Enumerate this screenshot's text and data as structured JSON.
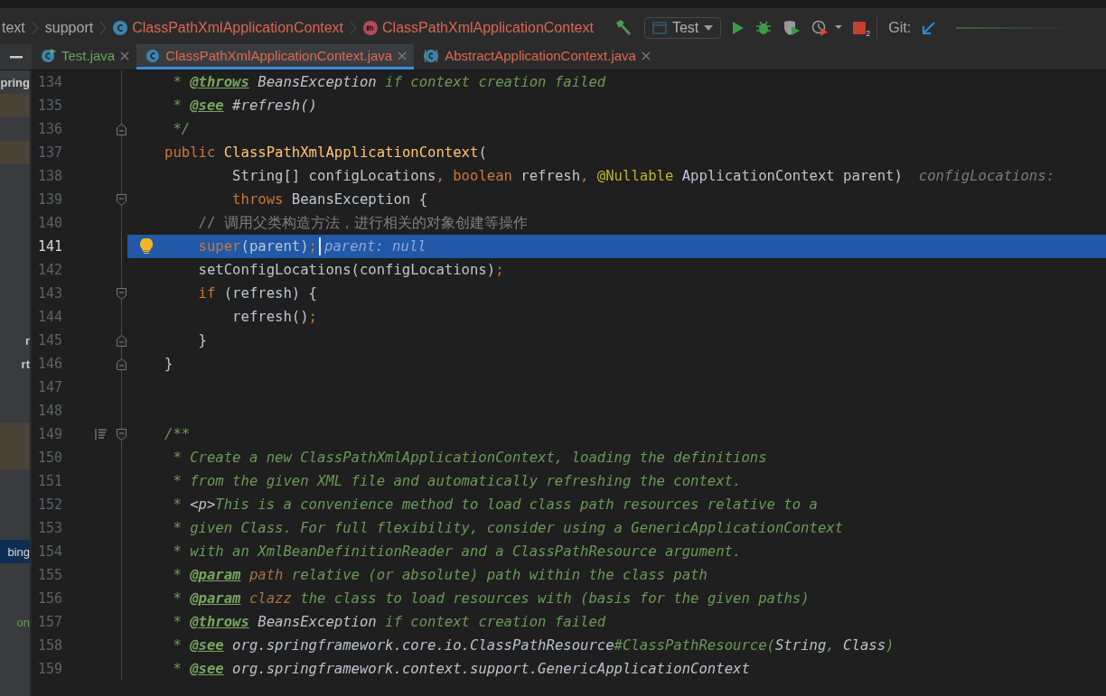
{
  "breadcrumbs": [
    {
      "text": "text",
      "kind": "plain"
    },
    {
      "text": "support",
      "kind": "plain"
    },
    {
      "text": "ClassPathXmlApplicationContext",
      "kind": "class"
    },
    {
      "text": "ClassPathXmlApplicationContext",
      "kind": "method"
    }
  ],
  "toolbar": {
    "run_config": "Test",
    "stop_count": "2",
    "git_label": "Git:"
  },
  "tabs": [
    {
      "label": "Test.java",
      "selected": false,
      "kind": "test-class",
      "color": "#62a85a"
    },
    {
      "label": "ClassPathXmlApplicationContext.java",
      "selected": true,
      "kind": "class",
      "color": "#e0694e"
    },
    {
      "label": "AbstractApplicationContext.java",
      "selected": false,
      "kind": "abstract-class",
      "color": "#e0694e"
    }
  ],
  "sidebar": {
    "items": [
      {
        "kind": "text",
        "text": "pring",
        "selected": false
      },
      {
        "kind": "highlight"
      },
      {
        "kind": "gap"
      },
      {
        "kind": "highlight"
      },
      {
        "kind": "gap"
      },
      {
        "kind": "gap"
      },
      {
        "kind": "gap"
      },
      {
        "kind": "gap"
      },
      {
        "kind": "gap"
      },
      {
        "kind": "gap"
      },
      {
        "kind": "gap"
      },
      {
        "kind": "text",
        "text": "r",
        "selected": false
      },
      {
        "kind": "text",
        "text": "rt",
        "selected": false
      },
      {
        "kind": "gap"
      },
      {
        "kind": "gap"
      },
      {
        "kind": "highlight"
      },
      {
        "kind": "highlight"
      },
      {
        "kind": "gap"
      },
      {
        "kind": "gap"
      },
      {
        "kind": "gap"
      },
      {
        "kind": "text",
        "text": "bing",
        "selected": true
      },
      {
        "kind": "gap"
      },
      {
        "kind": "gap"
      },
      {
        "kind": "modified",
        "text": "on",
        "selected": false
      }
    ]
  },
  "editor": {
    "lines": [
      {
        "number": "134",
        "current": false,
        "tokens": [
          {
            "text": " * ",
            "kind": "comment"
          },
          {
            "text": "@throws",
            "kind": "doc-tag"
          },
          {
            "text": " BeansException",
            "kind": "doc-ref"
          },
          {
            "text": " if context creation failed",
            "kind": "comment"
          }
        ]
      },
      {
        "number": "135",
        "current": false,
        "tokens": [
          {
            "text": " * ",
            "kind": "comment"
          },
          {
            "text": "@see",
            "kind": "doc-tag"
          },
          {
            "text": " #refresh()",
            "kind": "doc-ref"
          }
        ]
      },
      {
        "number": "136",
        "current": false,
        "markers": [
          {
            "kind": "fold-end"
          }
        ],
        "tokens": [
          {
            "text": " */",
            "kind": "comment"
          }
        ]
      },
      {
        "number": "137",
        "current": false,
        "tokens": [
          {
            "text": "public",
            "kind": "keyword"
          },
          {
            "text": " ClassPathXmlApplicationContext",
            "kind": "declaration"
          },
          {
            "text": "(",
            "kind": "plain"
          }
        ]
      },
      {
        "number": "138",
        "current": false,
        "hint": "configLocations:",
        "tokens": [
          {
            "text": "        String[] configLocations",
            "kind": "plain"
          },
          {
            "text": ",",
            "kind": "keyword"
          },
          {
            "text": " boolean",
            "kind": "keyword"
          },
          {
            "text": " refresh",
            "kind": "plain"
          },
          {
            "text": ",",
            "kind": "keyword"
          },
          {
            "text": " @Nullable",
            "kind": "annotation"
          },
          {
            "text": " ApplicationContext parent)",
            "kind": "plain"
          }
        ]
      },
      {
        "number": "139",
        "current": false,
        "markers": [
          {
            "kind": "fold-start"
          }
        ],
        "tokens": [
          {
            "text": "        throws",
            "kind": "keyword"
          },
          {
            "text": " BeansException {",
            "kind": "plain"
          }
        ]
      },
      {
        "number": "140",
        "current": false,
        "tokens": [
          {
            "text": "    // 调用父类构造方法，进行相关的对象创建等操作",
            "kind": "line-comment"
          }
        ]
      },
      {
        "number": "141",
        "current": true,
        "markers": [
          {
            "kind": "bulb"
          }
        ],
        "hint": "parent: null",
        "tokens": [
          {
            "text": "    super",
            "kind": "keyword"
          },
          {
            "text": "(parent)",
            "kind": "plain"
          },
          {
            "text": ";",
            "kind": "keyword"
          }
        ]
      },
      {
        "number": "142",
        "current": false,
        "tokens": [
          {
            "text": "    setConfigLocations(configLocations)",
            "kind": "plain"
          },
          {
            "text": ";",
            "kind": "keyword"
          }
        ]
      },
      {
        "number": "143",
        "current": false,
        "markers": [
          {
            "kind": "fold-start"
          }
        ],
        "tokens": [
          {
            "text": "    if",
            "kind": "keyword"
          },
          {
            "text": " (refresh) {",
            "kind": "plain"
          }
        ]
      },
      {
        "number": "144",
        "current": false,
        "tokens": [
          {
            "text": "        refresh()",
            "kind": "plain"
          },
          {
            "text": ";",
            "kind": "keyword"
          }
        ]
      },
      {
        "number": "145",
        "current": false,
        "markers": [
          {
            "kind": "fold-end"
          }
        ],
        "tokens": [
          {
            "text": "    }",
            "kind": "plain"
          }
        ]
      },
      {
        "number": "146",
        "current": false,
        "markers": [
          {
            "kind": "fold-end"
          }
        ],
        "tokens": [
          {
            "text": "}",
            "kind": "plain"
          }
        ]
      },
      {
        "number": "147",
        "current": false
      },
      {
        "number": "148",
        "current": false
      },
      {
        "number": "149",
        "current": false,
        "markers": [
          {
            "kind": "doc-list"
          },
          {
            "kind": "fold-start"
          }
        ],
        "tokens": [
          {
            "text": "/**",
            "kind": "comment"
          }
        ]
      },
      {
        "number": "150",
        "current": false,
        "tokens": [
          {
            "text": " * Create a new ClassPathXmlApplicationContext, loading the definitions",
            "kind": "comment"
          }
        ]
      },
      {
        "number": "151",
        "current": false,
        "tokens": [
          {
            "text": " * from the given XML file and automatically refreshing the context.",
            "kind": "comment"
          }
        ]
      },
      {
        "number": "152",
        "current": false,
        "tokens": [
          {
            "text": " * ",
            "kind": "comment"
          },
          {
            "text": "<p>",
            "kind": "doc-ref"
          },
          {
            "text": "This is a convenience method to load class path resources relative to a",
            "kind": "comment"
          }
        ]
      },
      {
        "number": "153",
        "current": false,
        "tokens": [
          {
            "text": " * given Class. For full flexibility, consider using a GenericApplicationContext",
            "kind": "comment"
          }
        ]
      },
      {
        "number": "154",
        "current": false,
        "tokens": [
          {
            "text": " * with an XmlBeanDefinitionReader and a ClassPathResource argument.",
            "kind": "comment"
          }
        ]
      },
      {
        "number": "155",
        "current": false,
        "tokens": [
          {
            "text": " * ",
            "kind": "comment"
          },
          {
            "text": "@param",
            "kind": "doc-tag"
          },
          {
            "text": " path",
            "kind": "doc-param"
          },
          {
            "text": " relative (or absolute) path within the class path",
            "kind": "comment"
          }
        ]
      },
      {
        "number": "156",
        "current": false,
        "tokens": [
          {
            "text": " * ",
            "kind": "comment"
          },
          {
            "text": "@param",
            "kind": "doc-tag"
          },
          {
            "text": " clazz",
            "kind": "doc-param"
          },
          {
            "text": " the class to load resources with (basis for the given paths)",
            "kind": "comment"
          }
        ]
      },
      {
        "number": "157",
        "current": false,
        "tokens": [
          {
            "text": " * ",
            "kind": "comment"
          },
          {
            "text": "@throws",
            "kind": "doc-tag"
          },
          {
            "text": " BeansException",
            "kind": "doc-ref"
          },
          {
            "text": " if context creation failed",
            "kind": "comment"
          }
        ]
      },
      {
        "number": "158",
        "current": false,
        "tokens": [
          {
            "text": " * ",
            "kind": "comment"
          },
          {
            "text": "@see",
            "kind": "doc-tag"
          },
          {
            "text": " org.springframework.core.io.ClassPathResource",
            "kind": "doc-ref"
          },
          {
            "text": "#ClassPathResource(",
            "kind": "comment"
          },
          {
            "text": "String",
            "kind": "doc-ref"
          },
          {
            "text": ", ",
            "kind": "comment"
          },
          {
            "text": "Class",
            "kind": "doc-ref"
          },
          {
            "text": ")",
            "kind": "comment"
          }
        ]
      },
      {
        "number": "159",
        "current": false,
        "tokens": [
          {
            "text": " * ",
            "kind": "comment"
          },
          {
            "text": "@see",
            "kind": "doc-tag"
          },
          {
            "text": " org.springframework.context.support.GenericApplicationContext",
            "kind": "doc-ref"
          }
        ]
      }
    ]
  }
}
